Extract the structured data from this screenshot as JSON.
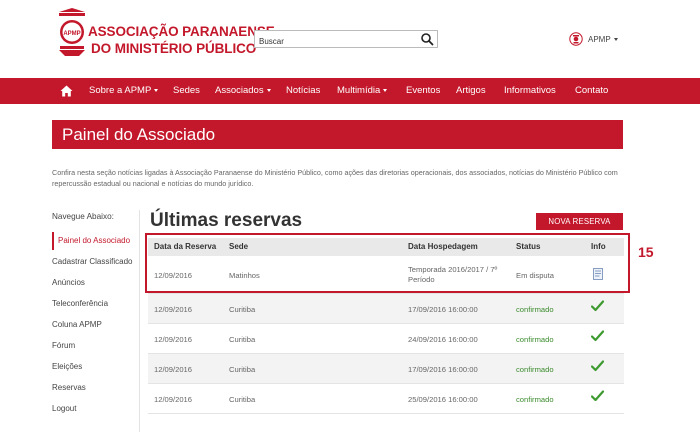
{
  "header": {
    "logo_line1": "ASSOCIAÇÃO PARANAENSE",
    "logo_line2": "DO MINISTÉRIO PÚBLICO",
    "logo_mark": "APMP",
    "search_placeholder": "Buscar",
    "user_label": "APMP"
  },
  "nav": {
    "items": [
      "Sobre a APMP",
      "Sedes",
      "Associados",
      "Notícias",
      "Multimídia",
      "Eventos",
      "Artigos",
      "Informativos",
      "Contato"
    ]
  },
  "page": {
    "title": "Painel do Associado",
    "intro": "Confira nesta seção notícias ligadas à Associação Paranaense do Ministério Público, como ações das diretorias operacionais, dos associados, notícias do Ministério Público com repercussão estadual ou nacional e notícias do mundo jurídico."
  },
  "sidebar": {
    "heading": "Navegue Abaixo:",
    "items": [
      "Painel do Associado",
      "Cadastrar Classificado",
      "Anúncios",
      "Teleconferência",
      "Coluna APMP",
      "Fórum",
      "Eleições",
      "Reservas",
      "Logout"
    ]
  },
  "main": {
    "title": "Últimas reservas",
    "new_button": "NOVA RESERVA",
    "annotation": "15",
    "columns": [
      "Data da Reserva",
      "Sede",
      "Data Hospedagem",
      "Status",
      "Info"
    ],
    "rows": [
      {
        "date": "12/09/2016",
        "sede": "Matinhos",
        "hosp_line1": "Temporada 2016/2017 / 7º",
        "hosp_line2": "Período",
        "status": "Em disputa",
        "info": "document-icon"
      },
      {
        "date": "12/09/2016",
        "sede": "Curitiba",
        "hosp_line1": "17/09/2016 16:00:00",
        "hosp_line2": "",
        "status": "confirmado",
        "info": "check-icon"
      },
      {
        "date": "12/09/2016",
        "sede": "Curitiba",
        "hosp_line1": "24/09/2016 16:00:00",
        "hosp_line2": "",
        "status": "confirmado",
        "info": "check-icon"
      },
      {
        "date": "12/09/2016",
        "sede": "Curitiba",
        "hosp_line1": "17/09/2016 16:00:00",
        "hosp_line2": "",
        "status": "confirmado",
        "info": "check-icon"
      },
      {
        "date": "12/09/2016",
        "sede": "Curitiba",
        "hosp_line1": "25/09/2016 16:00:00",
        "hosp_line2": "",
        "status": "confirmado",
        "info": "check-icon"
      }
    ]
  },
  "colors": {
    "brand_red": "#c3182b",
    "status_green": "#3c8c2f"
  }
}
